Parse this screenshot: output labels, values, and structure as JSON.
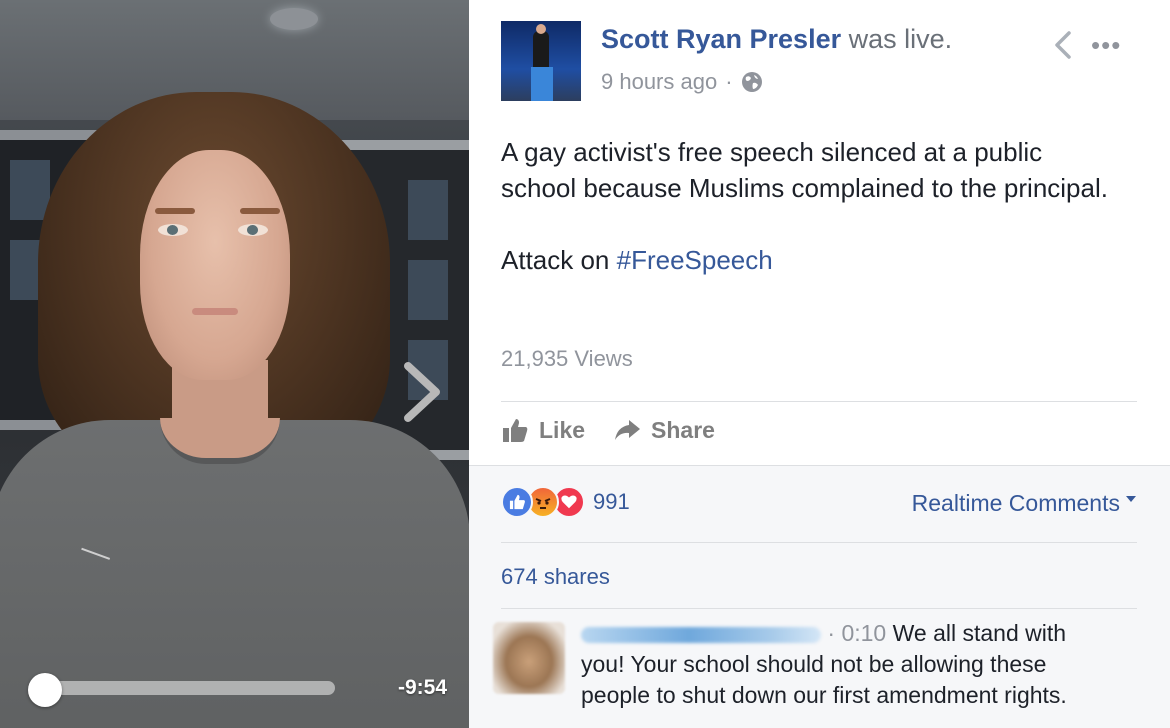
{
  "video": {
    "time_remaining": "-9:54",
    "progress": 0.0
  },
  "post": {
    "author_name": "Scott Ryan Presler",
    "author_suffix": "was live.",
    "timestamp": "9 hours ago",
    "separator": "·",
    "text_line_1": "A gay activist's free speech silenced at a public school because Muslims complained to the principal.",
    "text_line_2_prefix": "Attack on ",
    "hashtag": "#FreeSpeech",
    "views": "21,935 Views",
    "like_label": "Like",
    "share_label": "Share",
    "more_label": "•••"
  },
  "engagement": {
    "reactions": [
      "like",
      "angry",
      "love"
    ],
    "reaction_count": "991",
    "realtime_label": "Realtime Comments",
    "shares": "674 shares"
  },
  "comment": {
    "time": "0:10",
    "text": "We all stand with you! Your school should not be allowing these people to shut down our first amendment rights."
  },
  "colors": {
    "link_blue": "#365899",
    "meta_gray": "#90949c",
    "like_blue": "#4a7ce2",
    "love_red": "#f0394f"
  }
}
